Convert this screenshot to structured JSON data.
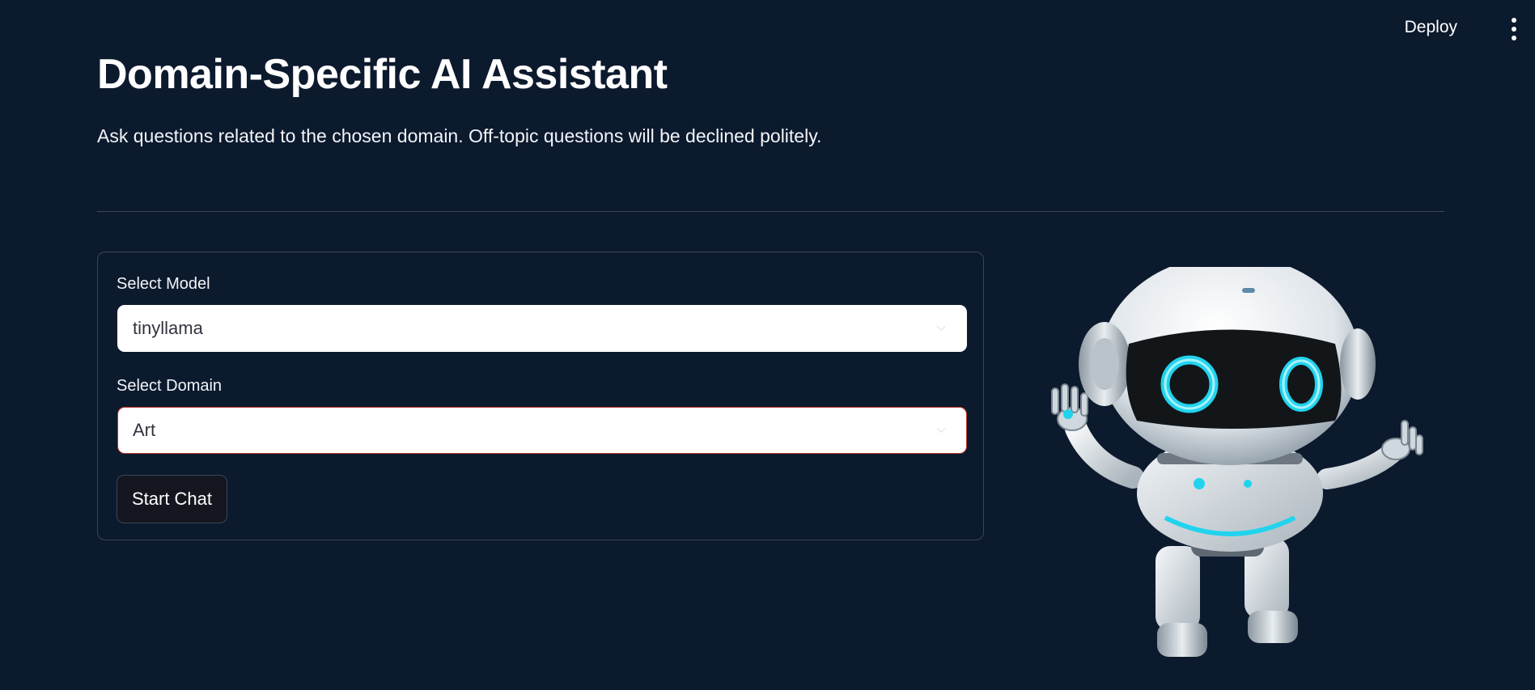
{
  "toolbar": {
    "deploy_label": "Deploy",
    "menu_icon": "more-vertical-icon"
  },
  "header": {
    "title": "Domain-Specific AI Assistant",
    "subtitle": "Ask questions related to the chosen domain. Off-topic questions will be declined politely."
  },
  "form": {
    "model_label": "Select Model",
    "model_value": "tinyllama",
    "domain_label": "Select Domain",
    "domain_value": "Art",
    "start_button_label": "Start Chat"
  },
  "illustration": {
    "icon": "robot-icon"
  },
  "colors": {
    "background": "#0c1a2e",
    "card_border": "#3a4658",
    "domain_select_border": "#c0392b",
    "robot_eye_glow": "#22d3ee"
  }
}
